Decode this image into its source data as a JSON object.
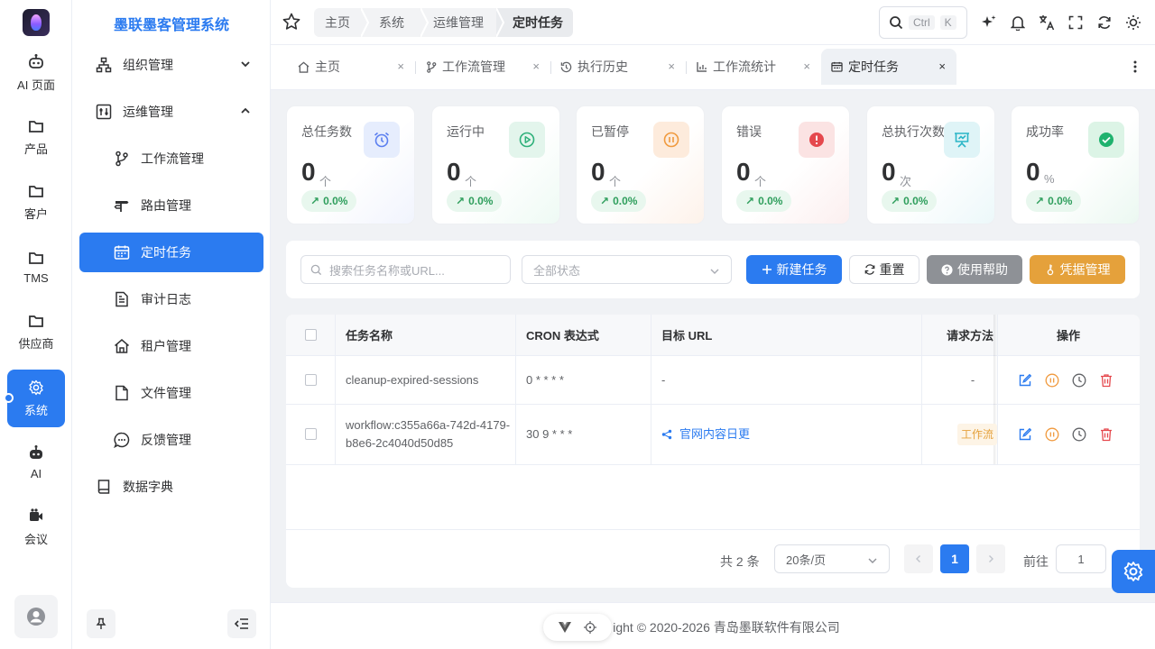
{
  "rail": {
    "items": [
      {
        "label": "AI 页面",
        "icon": "robot-icon"
      },
      {
        "label": "产品",
        "icon": "folder-icon"
      },
      {
        "label": "客户",
        "icon": "folder-icon"
      },
      {
        "label": "TMS",
        "icon": "folder-icon"
      },
      {
        "label": "供应商",
        "icon": "folder-icon"
      },
      {
        "label": "系统",
        "icon": "gear-icon",
        "active": true
      },
      {
        "label": "AI",
        "icon": "robot-icon"
      },
      {
        "label": "会议",
        "icon": "video-icon"
      }
    ]
  },
  "sidebar": {
    "title": "墨联墨客管理系统",
    "items": [
      {
        "label": "组织管理",
        "icon": "org-icon"
      },
      {
        "label": "运维管理",
        "icon": "ops-icon"
      },
      {
        "label": "工作流管理",
        "icon": "workflow-icon"
      },
      {
        "label": "路由管理",
        "icon": "route-icon"
      },
      {
        "label": "定时任务",
        "icon": "calendar-icon",
        "active": true
      },
      {
        "label": "审计日志",
        "icon": "document-icon"
      },
      {
        "label": "租户管理",
        "icon": "home-icon"
      },
      {
        "label": "文件管理",
        "icon": "file-icon"
      },
      {
        "label": "反馈管理",
        "icon": "chat-icon"
      },
      {
        "label": "数据字典",
        "icon": "book-icon"
      }
    ]
  },
  "header": {
    "breadcrumb": [
      "主页",
      "系统",
      "运维管理",
      "定时任务"
    ],
    "search_kbd": [
      "Ctrl",
      "K"
    ]
  },
  "tabs": [
    {
      "label": "主页",
      "icon": "home-icon"
    },
    {
      "label": "工作流管理",
      "icon": "workflow-icon"
    },
    {
      "label": "执行历史",
      "icon": "history-icon"
    },
    {
      "label": "工作流统计",
      "icon": "bar-chart-icon"
    },
    {
      "label": "定时任务",
      "icon": "calendar-icon",
      "active": true
    }
  ],
  "stats": [
    {
      "label": "总任务数",
      "value": "0",
      "unit": "个",
      "trend": "0.0%",
      "icon": "alarm-icon",
      "color": "#5b7ff0",
      "bg": "#e6edfd"
    },
    {
      "label": "运行中",
      "value": "0",
      "unit": "个",
      "trend": "0.0%",
      "icon": "play-icon",
      "color": "#2eb07a",
      "bg": "#e3f5ec"
    },
    {
      "label": "已暂停",
      "value": "0",
      "unit": "个",
      "trend": "0.0%",
      "icon": "pause-icon",
      "color": "#f09a3e",
      "bg": "#fdebdc"
    },
    {
      "label": "错误",
      "value": "0",
      "unit": "个",
      "trend": "0.0%",
      "icon": "error-icon",
      "color": "#e5484d",
      "bg": "#fbe3e3"
    },
    {
      "label": "总执行次数",
      "value": "0",
      "unit": "次",
      "trend": "0.0%",
      "icon": "presentation-icon",
      "color": "#2bb5c7",
      "bg": "#dff4f7"
    },
    {
      "label": "成功率",
      "value": "0",
      "unit": "%",
      "trend": "0.0%",
      "icon": "check-icon",
      "color": "#1fb26e",
      "bg": "#dcf4e6"
    }
  ],
  "filter": {
    "search_placeholder": "搜索任务名称或URL...",
    "status_placeholder": "全部状态",
    "new_button": "新建任务",
    "reset_button": "重置",
    "help_button": "使用帮助",
    "credential_button": "凭据管理"
  },
  "table": {
    "columns": [
      "任务名称",
      "CRON 表达式",
      "目标 URL",
      "请求方法",
      "操作"
    ],
    "rows": [
      {
        "name": "cleanup-expired-sessions",
        "cron": "0 * * * *",
        "url": "-",
        "method": "-"
      },
      {
        "name": "workflow:c355a66a-742d-4179-b8e6-2c4040d50d85",
        "cron": "30 9 * * *",
        "url": "官网内容日更",
        "method": "工作流"
      }
    ]
  },
  "pagination": {
    "total": "共 2 条",
    "page_size": "20条/页",
    "current_page": "1",
    "goto_label": "前往",
    "goto_value": "1"
  },
  "footer": {
    "copyright": "Copyright © 2020-2026  青岛墨联软件有限公司",
    "visible_copyright": "ight © 2020-2026  青岛墨联软件有限公司"
  }
}
